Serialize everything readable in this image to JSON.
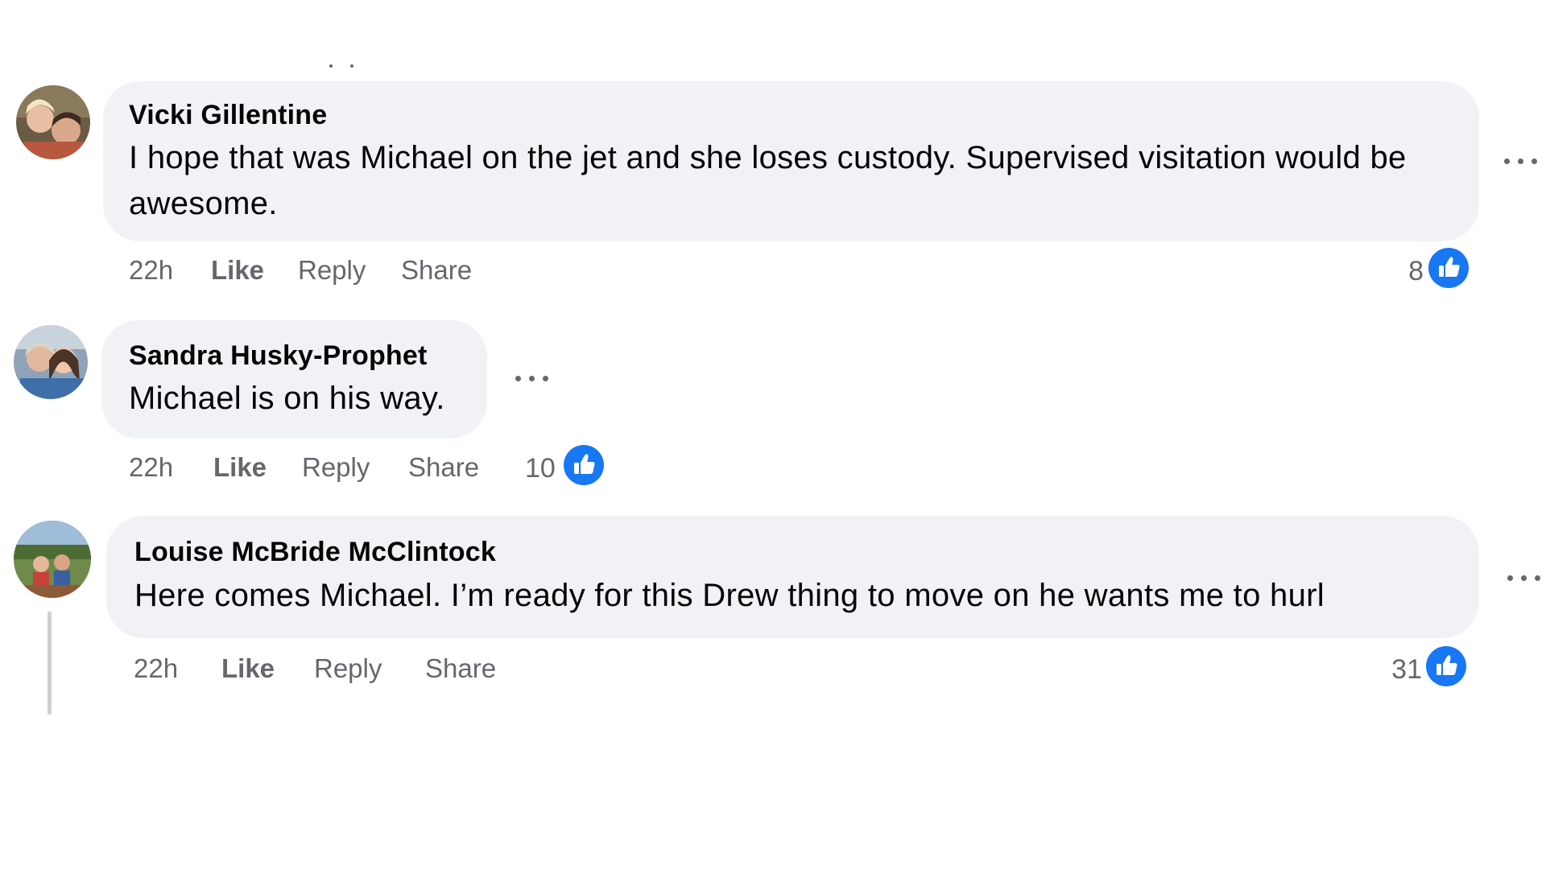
{
  "comments": [
    {
      "author": "Vicki Gillentine",
      "text_line1": "I hope that was Michael on the jet and she loses custody. Supervised visitation would be",
      "text_line2": "awesome.",
      "time": "22h",
      "like_label": "Like",
      "reply_label": "Reply",
      "share_label": "Share",
      "reaction_count": "8",
      "reaction_icon": "like-reaction-icon"
    },
    {
      "author": "Sandra Husky-Prophet",
      "text_line1": "Michael is on his way.",
      "time": "22h",
      "like_label": "Like",
      "reply_label": "Reply",
      "share_label": "Share",
      "reaction_count": "10",
      "reaction_icon": "like-reaction-icon"
    },
    {
      "author": "Louise McBride McClintock",
      "text_line1": "Here comes Michael. I’m ready for this Drew thing to move on he wants me to hurl",
      "time": "22h",
      "like_label": "Like",
      "reply_label": "Reply",
      "share_label": "Share",
      "reaction_count": "31",
      "reaction_icon": "like-reaction-icon"
    }
  ],
  "colors": {
    "bubble_bg": "#f0f2f5",
    "secondary_text": "#65676b",
    "primary_text": "#050505",
    "like_blue": "#1877f2"
  }
}
